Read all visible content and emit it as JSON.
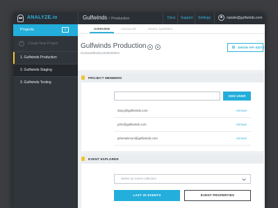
{
  "app": {
    "brand": "ANALYZE.io"
  },
  "breadcrumb": {
    "title": "Gulfwinds",
    "separator": "/",
    "sub": "Production"
  },
  "topnav": {
    "docs": "Docs",
    "support": "Support",
    "settings": "Settings",
    "user_email": "natalie@gulfwinds.com"
  },
  "sidebar": {
    "title": "Projects",
    "collapse_glyph": "«",
    "create_label": "Create New Project",
    "projects": [
      {
        "label": "1. Gulfwinds Production"
      },
      {
        "label": "2. Gulfwinds Staging"
      },
      {
        "label": "3. Gulfwinds Testing"
      }
    ]
  },
  "tabs": [
    "OVERVIEW",
    "VISUALIZE",
    "SAVED QUERIES"
  ],
  "project": {
    "title": "Gulfwinds Production",
    "id": "51eb2a3f843512630000001",
    "api_button": "SHOW API KEYS"
  },
  "members": {
    "title": "PROJECT MEMBERS",
    "add_button": "ADD USER",
    "rows": [
      {
        "email": "stacy@gulfwinds.com",
        "action": "remove"
      },
      {
        "email": "john@gulfwinds.com",
        "action": "remove"
      },
      {
        "email": "jehenderson@gulfwinds.com",
        "action": "remove"
      }
    ]
  },
  "explorer": {
    "title": "EVENT EXPLORER",
    "select_placeholder": "Select an event collection",
    "btn_last": "LAST 20 EVENTS",
    "btn_props": "EVENT PROPERTIES"
  },
  "colors": {
    "accent": "#23aedb",
    "highlight": "#f2c333",
    "sidebar": "#30353b",
    "topbar": "#2a2f35"
  }
}
